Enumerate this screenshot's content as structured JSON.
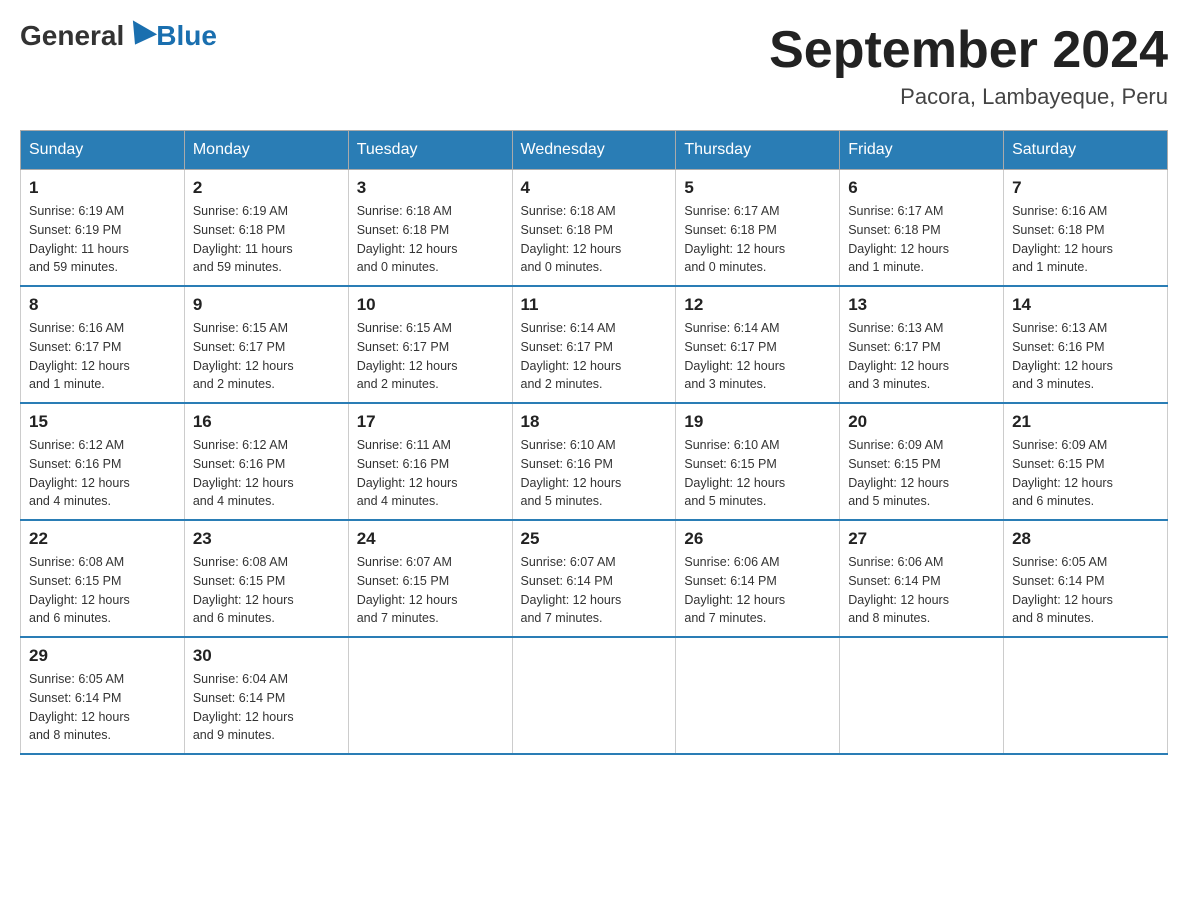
{
  "logo": {
    "general": "General",
    "blue": "Blue"
  },
  "title": "September 2024",
  "location": "Pacora, Lambayeque, Peru",
  "days_of_week": [
    "Sunday",
    "Monday",
    "Tuesday",
    "Wednesday",
    "Thursday",
    "Friday",
    "Saturday"
  ],
  "weeks": [
    [
      {
        "day": "1",
        "sunrise": "6:19 AM",
        "sunset": "6:19 PM",
        "daylight": "11 hours and 59 minutes."
      },
      {
        "day": "2",
        "sunrise": "6:19 AM",
        "sunset": "6:18 PM",
        "daylight": "11 hours and 59 minutes."
      },
      {
        "day": "3",
        "sunrise": "6:18 AM",
        "sunset": "6:18 PM",
        "daylight": "12 hours and 0 minutes."
      },
      {
        "day": "4",
        "sunrise": "6:18 AM",
        "sunset": "6:18 PM",
        "daylight": "12 hours and 0 minutes."
      },
      {
        "day": "5",
        "sunrise": "6:17 AM",
        "sunset": "6:18 PM",
        "daylight": "12 hours and 0 minutes."
      },
      {
        "day": "6",
        "sunrise": "6:17 AM",
        "sunset": "6:18 PM",
        "daylight": "12 hours and 1 minute."
      },
      {
        "day": "7",
        "sunrise": "6:16 AM",
        "sunset": "6:18 PM",
        "daylight": "12 hours and 1 minute."
      }
    ],
    [
      {
        "day": "8",
        "sunrise": "6:16 AM",
        "sunset": "6:17 PM",
        "daylight": "12 hours and 1 minute."
      },
      {
        "day": "9",
        "sunrise": "6:15 AM",
        "sunset": "6:17 PM",
        "daylight": "12 hours and 2 minutes."
      },
      {
        "day": "10",
        "sunrise": "6:15 AM",
        "sunset": "6:17 PM",
        "daylight": "12 hours and 2 minutes."
      },
      {
        "day": "11",
        "sunrise": "6:14 AM",
        "sunset": "6:17 PM",
        "daylight": "12 hours and 2 minutes."
      },
      {
        "day": "12",
        "sunrise": "6:14 AM",
        "sunset": "6:17 PM",
        "daylight": "12 hours and 3 minutes."
      },
      {
        "day": "13",
        "sunrise": "6:13 AM",
        "sunset": "6:17 PM",
        "daylight": "12 hours and 3 minutes."
      },
      {
        "day": "14",
        "sunrise": "6:13 AM",
        "sunset": "6:16 PM",
        "daylight": "12 hours and 3 minutes."
      }
    ],
    [
      {
        "day": "15",
        "sunrise": "6:12 AM",
        "sunset": "6:16 PM",
        "daylight": "12 hours and 4 minutes."
      },
      {
        "day": "16",
        "sunrise": "6:12 AM",
        "sunset": "6:16 PM",
        "daylight": "12 hours and 4 minutes."
      },
      {
        "day": "17",
        "sunrise": "6:11 AM",
        "sunset": "6:16 PM",
        "daylight": "12 hours and 4 minutes."
      },
      {
        "day": "18",
        "sunrise": "6:10 AM",
        "sunset": "6:16 PM",
        "daylight": "12 hours and 5 minutes."
      },
      {
        "day": "19",
        "sunrise": "6:10 AM",
        "sunset": "6:15 PM",
        "daylight": "12 hours and 5 minutes."
      },
      {
        "day": "20",
        "sunrise": "6:09 AM",
        "sunset": "6:15 PM",
        "daylight": "12 hours and 5 minutes."
      },
      {
        "day": "21",
        "sunrise": "6:09 AM",
        "sunset": "6:15 PM",
        "daylight": "12 hours and 6 minutes."
      }
    ],
    [
      {
        "day": "22",
        "sunrise": "6:08 AM",
        "sunset": "6:15 PM",
        "daylight": "12 hours and 6 minutes."
      },
      {
        "day": "23",
        "sunrise": "6:08 AM",
        "sunset": "6:15 PM",
        "daylight": "12 hours and 6 minutes."
      },
      {
        "day": "24",
        "sunrise": "6:07 AM",
        "sunset": "6:15 PM",
        "daylight": "12 hours and 7 minutes."
      },
      {
        "day": "25",
        "sunrise": "6:07 AM",
        "sunset": "6:14 PM",
        "daylight": "12 hours and 7 minutes."
      },
      {
        "day": "26",
        "sunrise": "6:06 AM",
        "sunset": "6:14 PM",
        "daylight": "12 hours and 7 minutes."
      },
      {
        "day": "27",
        "sunrise": "6:06 AM",
        "sunset": "6:14 PM",
        "daylight": "12 hours and 8 minutes."
      },
      {
        "day": "28",
        "sunrise": "6:05 AM",
        "sunset": "6:14 PM",
        "daylight": "12 hours and 8 minutes."
      }
    ],
    [
      {
        "day": "29",
        "sunrise": "6:05 AM",
        "sunset": "6:14 PM",
        "daylight": "12 hours and 8 minutes."
      },
      {
        "day": "30",
        "sunrise": "6:04 AM",
        "sunset": "6:14 PM",
        "daylight": "12 hours and 9 minutes."
      },
      null,
      null,
      null,
      null,
      null
    ]
  ],
  "labels": {
    "sunrise": "Sunrise:",
    "sunset": "Sunset:",
    "daylight": "Daylight:"
  }
}
